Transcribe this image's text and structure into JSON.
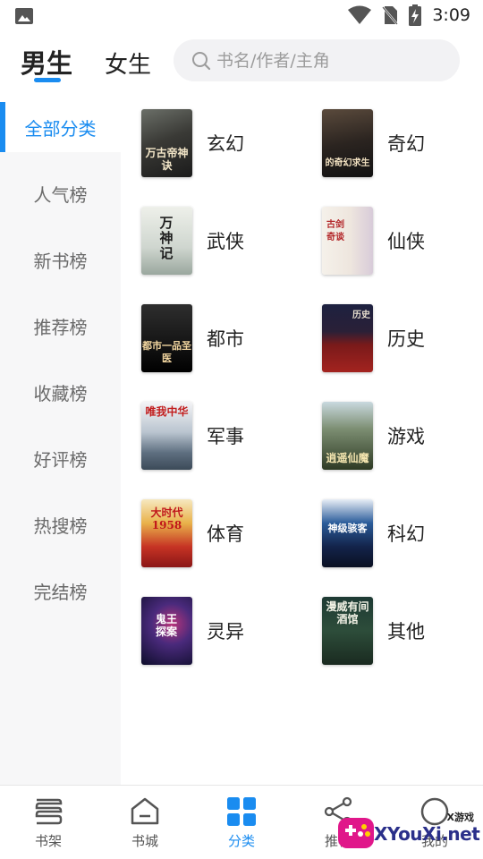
{
  "status_bar": {
    "time": "3:09"
  },
  "header": {
    "tabs": [
      {
        "label": "男生",
        "active": true
      },
      {
        "label": "女生",
        "active": false
      }
    ],
    "search_placeholder": "书名/作者/主角"
  },
  "sidebar": {
    "items": [
      {
        "label": "全部分类",
        "active": true
      },
      {
        "label": "人气榜"
      },
      {
        "label": "新书榜"
      },
      {
        "label": "推荐榜"
      },
      {
        "label": "收藏榜"
      },
      {
        "label": "好评榜"
      },
      {
        "label": "热搜榜"
      },
      {
        "label": "完结榜"
      }
    ]
  },
  "categories": [
    {
      "label": "玄幻",
      "cover_text": "万古帝神诀"
    },
    {
      "label": "奇幻",
      "cover_text": "的奇幻求生"
    },
    {
      "label": "武侠",
      "cover_text": "万神记"
    },
    {
      "label": "仙侠",
      "cover_text": "古剑奇谈"
    },
    {
      "label": "都市",
      "cover_text": "都市一品圣医"
    },
    {
      "label": "历史",
      "cover_text": "历史"
    },
    {
      "label": "军事",
      "cover_text": "唯我中华"
    },
    {
      "label": "游戏",
      "cover_text": "逍遥仙魔"
    },
    {
      "label": "体育",
      "cover_text": "大时代1958"
    },
    {
      "label": "科幻",
      "cover_text": "神级骇客"
    },
    {
      "label": "灵异",
      "cover_text": "鬼王探案"
    },
    {
      "label": "其他",
      "cover_text": "漫威有间酒馆"
    }
  ],
  "bottom_nav": {
    "items": [
      {
        "label": "书架",
        "icon": "bookshelf-icon"
      },
      {
        "label": "书城",
        "icon": "bookstore-icon"
      },
      {
        "label": "分类",
        "icon": "category-icon",
        "active": true
      },
      {
        "label": "推荐",
        "icon": "share-icon"
      },
      {
        "label": "我的",
        "icon": "profile-icon"
      }
    ]
  },
  "watermark": {
    "top": "X游戏",
    "main": "XYouXi.net"
  },
  "colors": {
    "accent": "#1a8cf0",
    "sidebar_bg": "#f7f7f8",
    "search_bg": "#f2f2f4"
  }
}
